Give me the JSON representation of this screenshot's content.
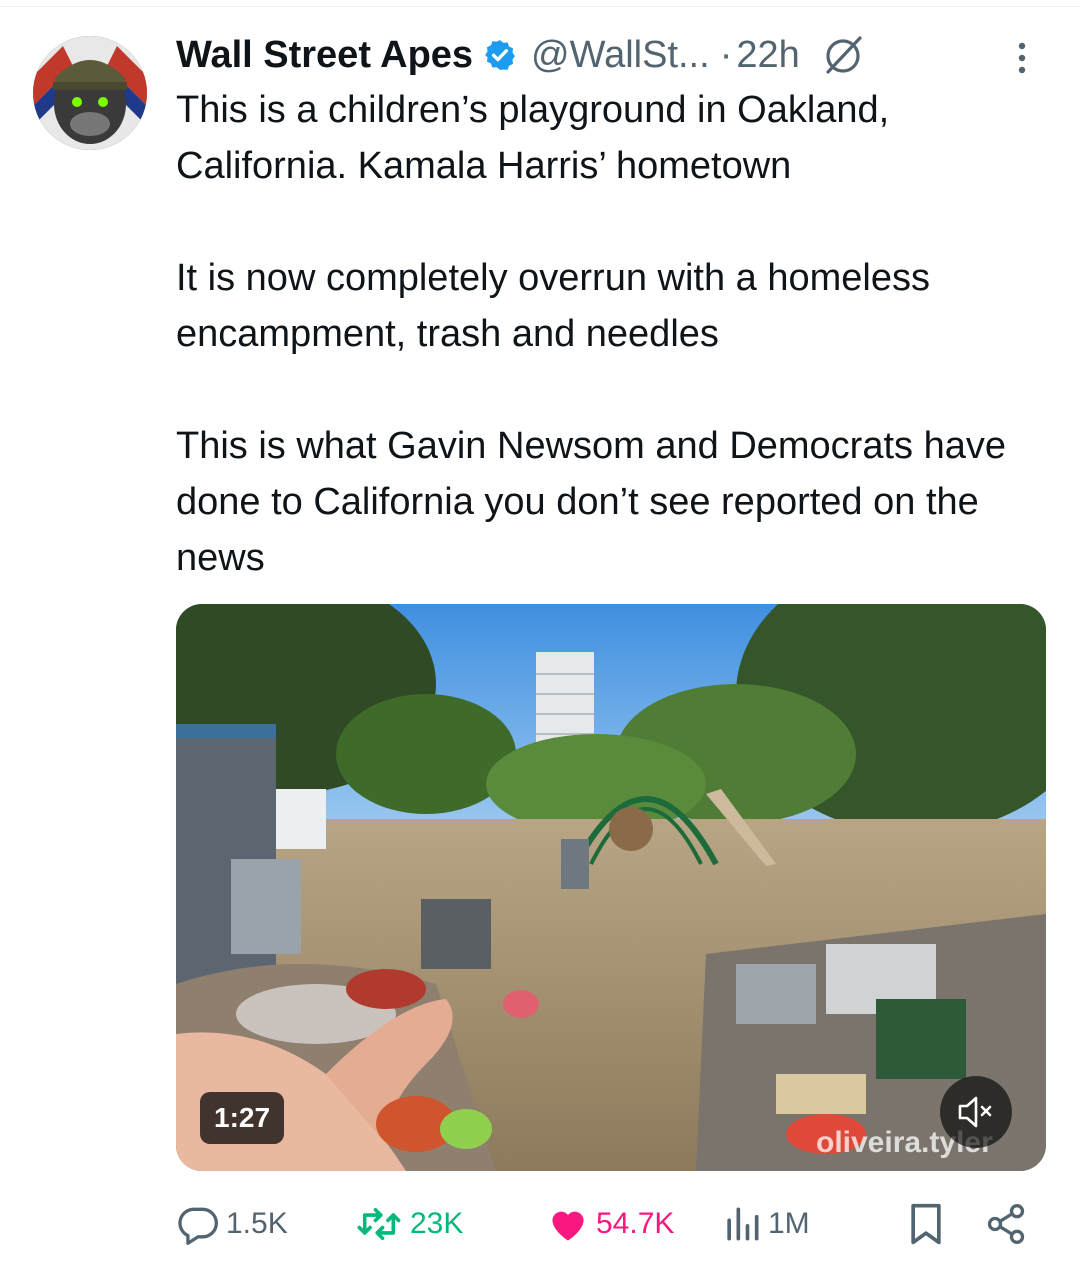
{
  "tweet": {
    "display_name": "Wall Street Apes",
    "handle": "@WallSt...",
    "separator": "·",
    "time": "22h",
    "paragraphs": [
      "This is a children’s playground in Oakland, California. Kamala Harris’ hometown",
      "It is now completely overrun with a homeless encampment, trash and needles",
      "This is what Gavin Newsom and Democrats have done to California you don’t see reported on the news"
    ]
  },
  "media": {
    "duration": "1:27",
    "watermark": "oliveira.tyler",
    "mute_icon": "speaker-muted-icon"
  },
  "actions": {
    "replies": "1.5K",
    "reposts": "23K",
    "likes": "54.7K",
    "views": "1M"
  },
  "icons": {
    "verified": "verified-badge-icon",
    "grok": "grok-icon",
    "more": "more-vertical-icon",
    "reply": "reply-icon",
    "repost": "repost-icon",
    "like": "heart-icon",
    "views": "views-icon",
    "bookmark": "bookmark-icon",
    "share": "share-icon"
  },
  "colors": {
    "text": "#0f1419",
    "secondary": "#536471",
    "verified_blue": "#1d9bf0",
    "repost_green": "#00ba7c",
    "like_pink": "#f91880"
  }
}
